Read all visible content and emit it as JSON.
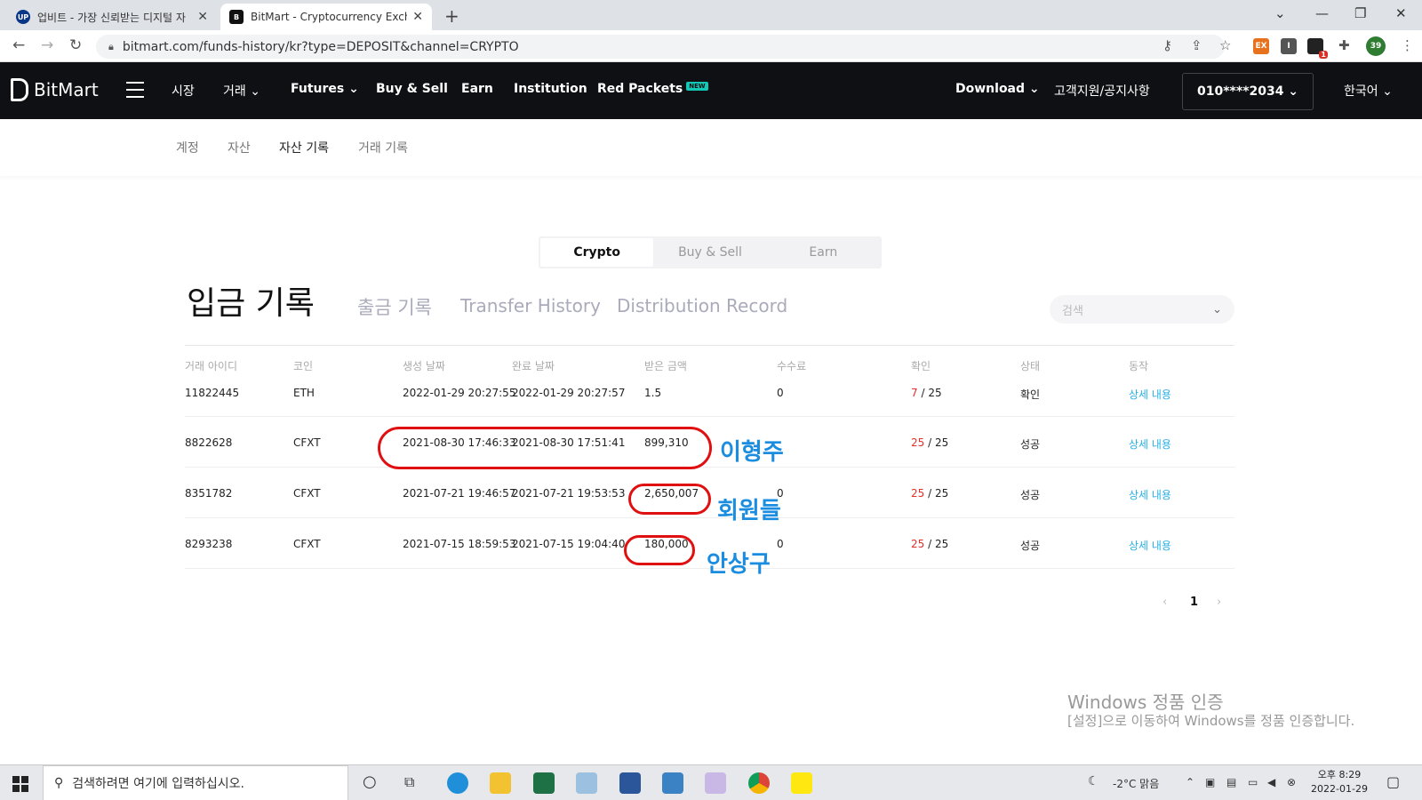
{
  "browser": {
    "tabs": [
      {
        "title": "업비트 - 가장 신뢰받는 디지털 자",
        "favicon": "UP",
        "color": "#093687"
      },
      {
        "title": "BitMart - Cryptocurrency Excha",
        "favicon": "B",
        "color": "#111111"
      }
    ],
    "url": "bitmart.com/funds-history/kr?type=DEPOSIT&channel=CRYPTO",
    "extension_badge": "1",
    "profile_badge": "39"
  },
  "nav": {
    "logo": "BitMart",
    "items": [
      "시장",
      "거래",
      "Futures",
      "Buy & Sell",
      "Earn",
      "Institution",
      "Red Packets"
    ],
    "new_badge": "NEW",
    "download": "Download",
    "support": "고객지원/공지사항",
    "account": "010****2034",
    "language": "한국어"
  },
  "subnav": {
    "items": [
      "계정",
      "자산",
      "자산 기록",
      "거래 기록"
    ],
    "active": "자산 기록"
  },
  "segmented": {
    "items": [
      "Crypto",
      "Buy & Sell",
      "Earn"
    ],
    "active": "Crypto"
  },
  "history_tabs": [
    "입금 기록",
    "출금 기록",
    "Transfer History",
    "Distribution Record"
  ],
  "search_placeholder": "검색",
  "table": {
    "headers": [
      "거래 아이디",
      "코인",
      "생성 날짜",
      "완료 날짜",
      "받은 금액",
      "수수료",
      "확인",
      "상태",
      "동작"
    ],
    "rows": [
      {
        "id": "11822445",
        "coin": "ETH",
        "created": "2022-01-29 20:27:55",
        "completed": "2022-01-29 20:27:57",
        "amount": "1.5",
        "fee": "0",
        "conf_done": "7",
        "conf_total": "/ 25",
        "status": "확인",
        "action": "상세 내용"
      },
      {
        "id": "8822628",
        "coin": "CFXT",
        "created": "2021-08-30 17:46:33",
        "completed": "2021-08-30 17:51:41",
        "amount": "899,310",
        "fee": "",
        "conf_done": "25",
        "conf_total": "/ 25",
        "status": "성공",
        "action": "상세 내용"
      },
      {
        "id": "8351782",
        "coin": "CFXT",
        "created": "2021-07-21 19:46:57",
        "completed": "2021-07-21 19:53:53",
        "amount": "2,650,007",
        "fee": "0",
        "conf_done": "25",
        "conf_total": "/ 25",
        "status": "성공",
        "action": "상세 내용"
      },
      {
        "id": "8293238",
        "coin": "CFXT",
        "created": "2021-07-15 18:59:53",
        "completed": "2021-07-15 19:04:40",
        "amount": "180,000",
        "fee": "0",
        "conf_done": "25",
        "conf_total": "/ 25",
        "status": "성공",
        "action": "상세 내용"
      }
    ]
  },
  "annotations": [
    "이형주",
    "회원들",
    "안상구"
  ],
  "pagination": {
    "prev": "‹",
    "current": "1",
    "next": "›"
  },
  "watermark": {
    "line1": "Windows 정품 인증",
    "line2": "[설정]으로 이동하여 Windows를 정품 인증합니다."
  },
  "taskbar": {
    "search": "검색하려면 여기에 입력하십시오.",
    "weather": "-2°C  맑음",
    "time": "오후 8:29",
    "date": "2022-01-29"
  }
}
